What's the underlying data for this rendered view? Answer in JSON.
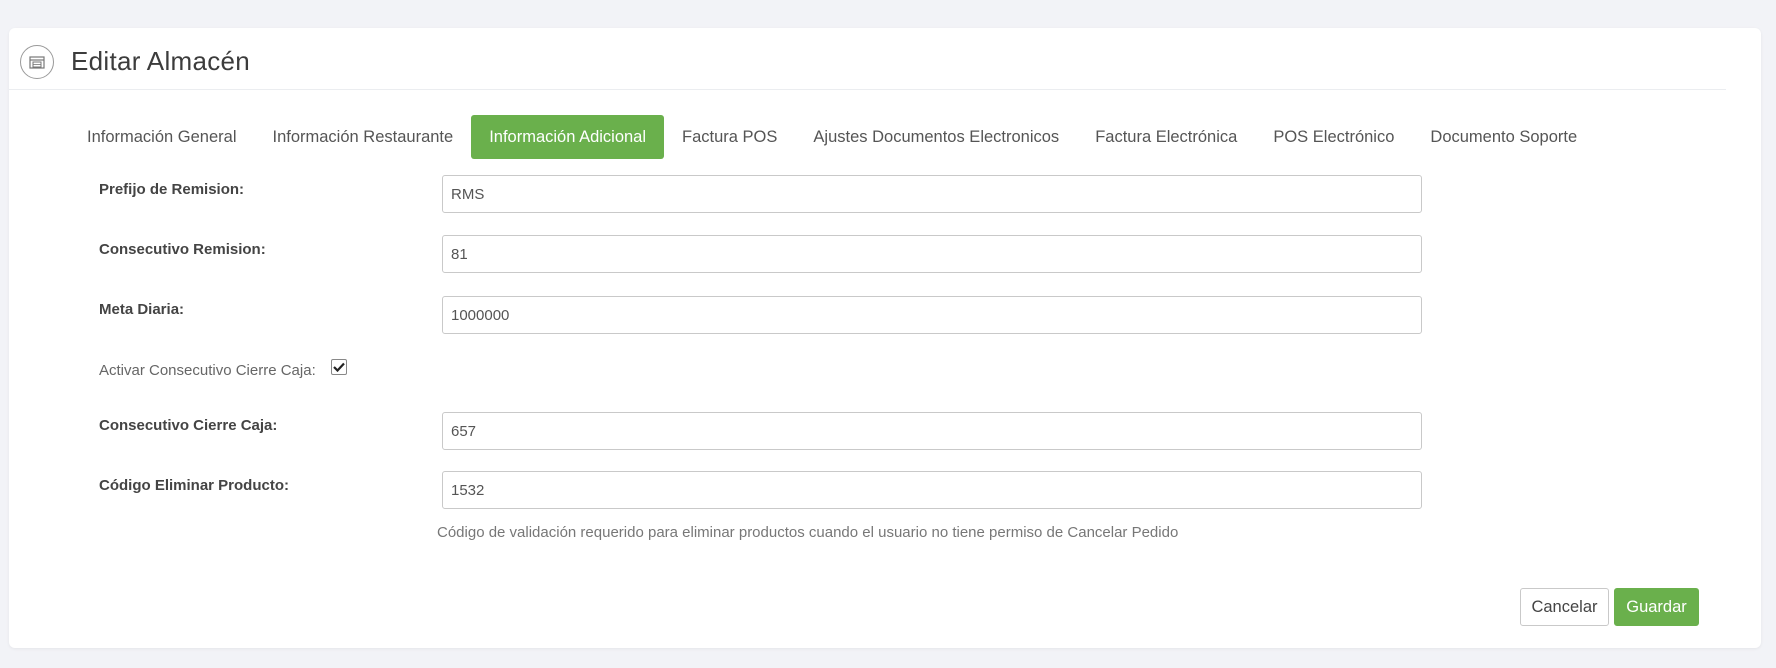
{
  "page": {
    "title": "Editar Almacén",
    "header_icon": "warehouse-icon"
  },
  "tabs": [
    {
      "label": "Información General",
      "active": false
    },
    {
      "label": "Información Restaurante",
      "active": false
    },
    {
      "label": "Información Adicional",
      "active": true
    },
    {
      "label": "Factura POS",
      "active": false
    },
    {
      "label": "Ajustes Documentos Electronicos",
      "active": false
    },
    {
      "label": "Factura Electrónica",
      "active": false
    },
    {
      "label": "POS Electrónico",
      "active": false
    },
    {
      "label": "Documento Soporte",
      "active": false
    }
  ],
  "form": {
    "prefijo_remision": {
      "label": "Prefijo de Remision:",
      "value": "RMS"
    },
    "consecutivo_remision": {
      "label": "Consecutivo Remision:",
      "value": "81"
    },
    "meta_diaria": {
      "label": "Meta Diaria:",
      "value": "1000000"
    },
    "activar_consecutivo": {
      "label": "Activar Consecutivo Cierre Caja:",
      "checked": true
    },
    "consecutivo_cierre": {
      "label": "Consecutivo Cierre Caja:",
      "value": "657"
    },
    "codigo_eliminar": {
      "label": "Código Eliminar Producto:",
      "value": "1532"
    },
    "help_text": "Código de validación requerido para eliminar productos cuando el usuario no tiene permiso de Cancelar Pedido"
  },
  "actions": {
    "cancel_label": "Cancelar",
    "save_label": "Guardar"
  },
  "colors": {
    "accent": "#6ab04c",
    "background": "#f2f3f7"
  }
}
